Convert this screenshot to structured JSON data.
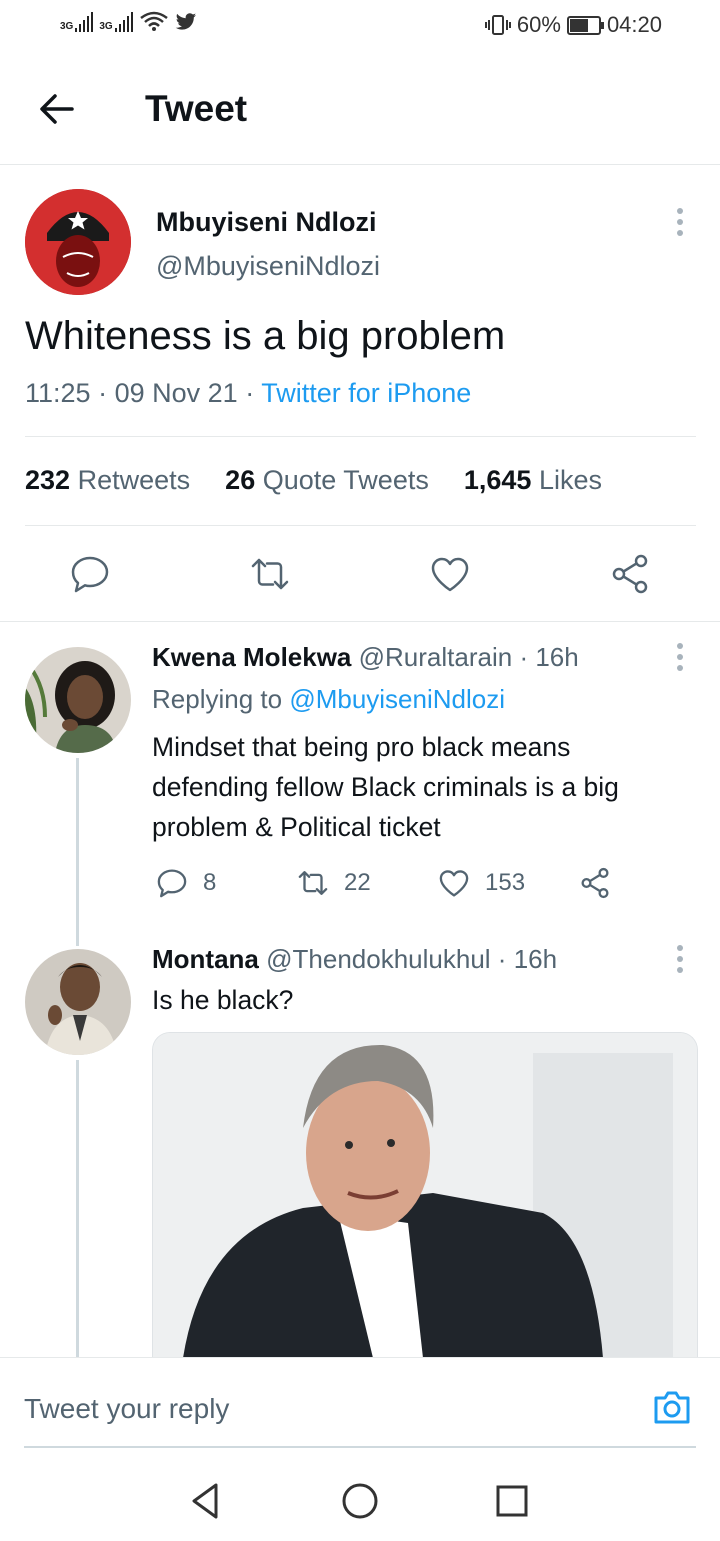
{
  "status_bar": {
    "signal1": "3G",
    "signal2": "3G",
    "battery_percent": "60%",
    "battery_level": 0.6,
    "time": "04:20"
  },
  "header": {
    "title": "Tweet",
    "back_icon": "arrow-left-icon"
  },
  "tweet": {
    "author_name": "Mbuyiseni Ndlozi",
    "author_handle": "@MbuyiseniNdlozi",
    "text": "Whiteness is a big problem",
    "time": "11:25",
    "date": "09 Nov 21",
    "source": "Twitter for iPhone",
    "retweets_count": "232",
    "retweets_label": "Retweets",
    "quotes_count": "26",
    "quotes_label": "Quote Tweets",
    "likes_count": "1,645",
    "likes_label": "Likes"
  },
  "replies": [
    {
      "name": "Kwena Molekwa",
      "handle": "@Ruraltarain",
      "age": "16h",
      "replying_label": "Replying to",
      "replying_to": "@MbuyiseniNdlozi",
      "text": "Mindset that being pro black means defending fellow Black criminals is a big problem & Political ticket",
      "reply_count": "8",
      "retweet_count": "22",
      "like_count": "153"
    },
    {
      "name": "Montana",
      "handle": "@Thendokhulukhul",
      "age": "16h",
      "text": "Is he black?"
    }
  ],
  "composer": {
    "placeholder": "Tweet your reply"
  },
  "colors": {
    "link": "#1d9bf0",
    "text": "#0f1419",
    "muted": "#536471",
    "divider": "#e6e9ea"
  }
}
